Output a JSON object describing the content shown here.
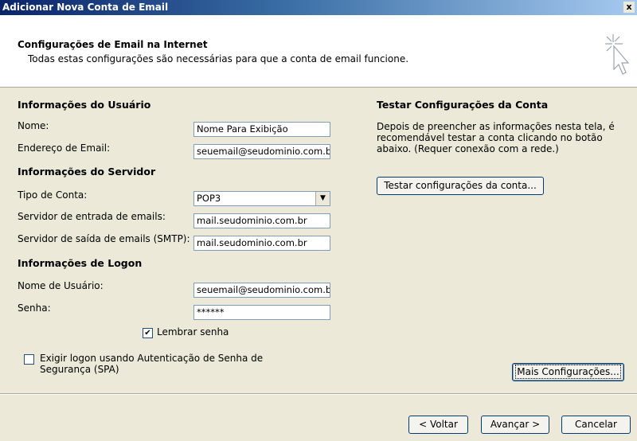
{
  "window": {
    "title": "Adicionar Nova Conta de Email",
    "close_glyph": "x"
  },
  "header": {
    "title": "Configurações de Email na Internet",
    "subtitle": "Todas estas configurações são necessárias para que a conta de email funcione."
  },
  "user_info": {
    "section": "Informações do Usuário",
    "name_label": "Nome:",
    "name_value": "Nome Para Exibição",
    "email_label": "Endereço de Email:",
    "email_value": "seuemail@seudominio.com.br"
  },
  "server_info": {
    "section": "Informações do Servidor",
    "account_type_label": "Tipo de Conta:",
    "account_type_value": "POP3",
    "incoming_label": "Servidor de entrada de emails:",
    "incoming_value": "mail.seudominio.com.br",
    "outgoing_label": "Servidor de saída de emails (SMTP):",
    "outgoing_value": "mail.seudominio.com.br"
  },
  "logon_info": {
    "section": "Informações de Logon",
    "username_label": "Nome de Usuário:",
    "username_value": "seuemail@seudominio.com.br",
    "password_label": "Senha:",
    "password_value": "******",
    "remember_label": "Lembrar senha",
    "remember_checked": true,
    "spa_label": "Exigir logon usando Autenticação de Senha de Segurança (SPA)",
    "spa_checked": false
  },
  "test_settings": {
    "section": "Testar Configurações da Conta",
    "description": "Depois de preencher as informações nesta tela, é recomendável testar a conta clicando no botão abaixo. (Requer conexão com a rede.)",
    "test_button": "Testar configurações da conta..."
  },
  "buttons": {
    "more_settings": "Mais Configurações...",
    "back": "< Voltar",
    "next": "Avançar >",
    "cancel": "Cancelar"
  },
  "colors": {
    "titlebar_start": "#0a246a",
    "titlebar_end": "#a6caf0",
    "dialog_bg": "#ece9d8",
    "field_border": "#7f9db9"
  }
}
